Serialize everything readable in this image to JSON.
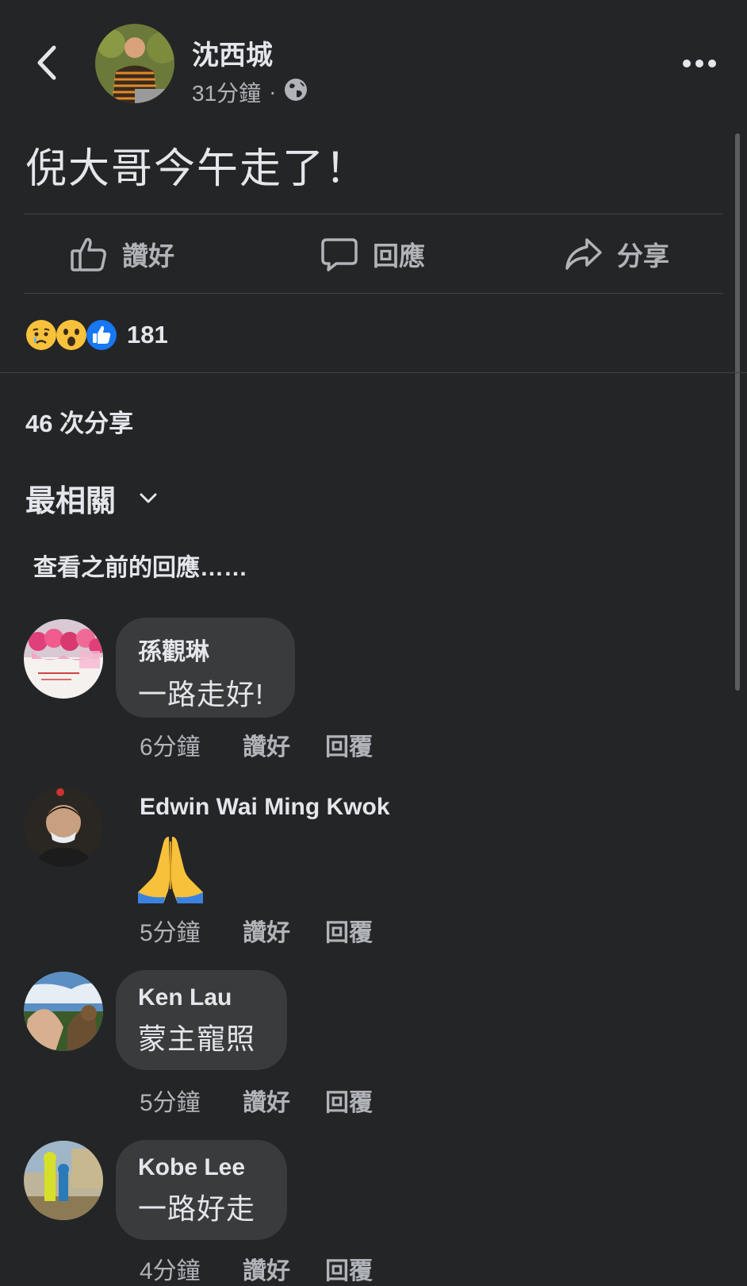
{
  "post": {
    "author": "沈西城",
    "time": "31分鐘",
    "separator": "·",
    "audience_icon": "globe-icon",
    "text": "倪大哥今午走了！"
  },
  "actions": {
    "like_label": "讚好",
    "comment_label": "回應",
    "share_label": "分享"
  },
  "reactions": {
    "icons": [
      "sad-reaction-icon",
      "wow-reaction-icon",
      "like-reaction-icon"
    ],
    "count": "181"
  },
  "shares_text": "46 次分享",
  "sort_label": "最相關",
  "view_previous": "查看之前的回應……",
  "comments": [
    {
      "name": "孫觀琳",
      "text": "一路走好!",
      "time": "6分鐘",
      "like": "讚好",
      "reply": "回覆"
    },
    {
      "name": "Edwin Wai Ming Kwok",
      "text": "🙏",
      "time": "5分鐘",
      "like": "讚好",
      "reply": "回覆"
    },
    {
      "name": "Ken Lau",
      "text": "蒙主寵照",
      "time": "5分鐘",
      "like": "讚好",
      "reply": "回覆"
    },
    {
      "name": "Kobe Lee",
      "text": "一路好走",
      "time": "4分鐘",
      "like": "讚好",
      "reply": "回覆"
    }
  ],
  "colors": {
    "background": "#242526",
    "bubble": "#3a3b3c",
    "text_primary": "#e4e6eb",
    "text_secondary": "#b0b3b8",
    "like_blue": "#1877f2"
  }
}
